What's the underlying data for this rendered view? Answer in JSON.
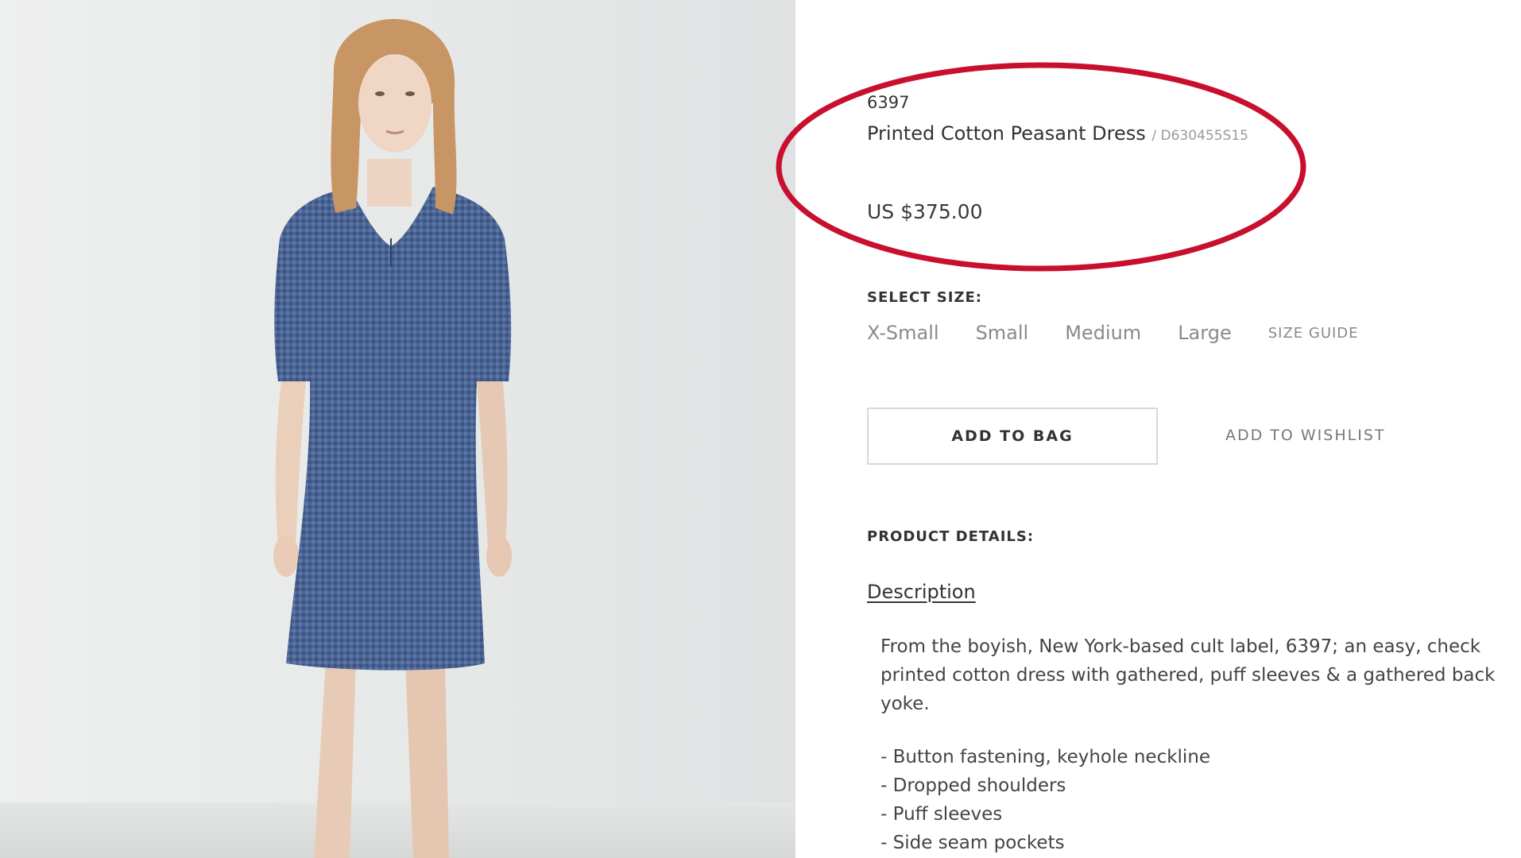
{
  "product": {
    "brand": "6397",
    "name": "Printed Cotton Peasant Dress",
    "sku": "/ D630455S15",
    "price": "US $375.00"
  },
  "size_selector": {
    "label": "SELECT SIZE:",
    "options": [
      "X-Small",
      "Small",
      "Medium",
      "Large"
    ],
    "size_guide": "SIZE GUIDE"
  },
  "actions": {
    "add_to_bag": "ADD TO BAG",
    "add_to_wishlist": "ADD TO WISHLIST"
  },
  "details": {
    "heading": "PRODUCT DETAILS:",
    "description_link": "Description",
    "description_text": "From the boyish, New York-based cult label, 6397; an easy, check printed cotton dress with gathered, puff sleeves & a gathered back yoke.",
    "bullets": [
      "Button fastening, keyhole neckline",
      "Dropped shoulders",
      "Puff sleeves",
      "Side seam pockets"
    ]
  },
  "colors": {
    "highlight_ellipse": "#c8102e",
    "dress": "#4a6494"
  }
}
